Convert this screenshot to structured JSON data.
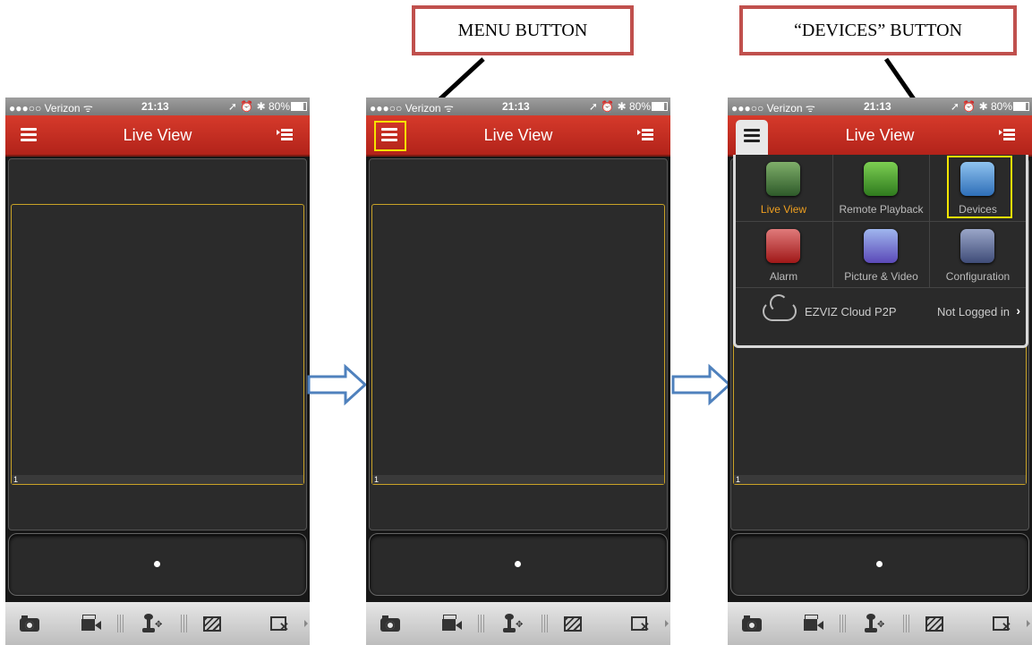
{
  "annotations": {
    "menu_label": "MENU BUTTON",
    "devices_label": "“DEVICES” BUTTON",
    "border_color": "#c0504d",
    "highlight_color": "#f5e600"
  },
  "statusbar": {
    "carrier": "●●●○○ Verizon ᯤ",
    "time": "21:13",
    "right": "➚ ⏰ ✱ 80%"
  },
  "navbar": {
    "title": "Live View",
    "accent": "#c62e22"
  },
  "viewer": {
    "channel_number": "1"
  },
  "toolbar": {
    "icons": [
      "camera-icon",
      "record-video-icon",
      "ptz-joystick-icon",
      "image-quality-icon",
      "close-window-icon"
    ]
  },
  "menu": {
    "items": [
      {
        "label": "Live View",
        "icon": "live-view-icon",
        "active": true
      },
      {
        "label": "Remote Playback",
        "icon": "remote-playback-icon"
      },
      {
        "label": "Devices",
        "icon": "devices-icon"
      },
      {
        "label": "Alarm",
        "icon": "alarm-icon"
      },
      {
        "label": "Picture & Video",
        "icon": "picture-video-icon"
      },
      {
        "label": "Configuration",
        "icon": "configuration-icon"
      }
    ],
    "cloud_label": "EZVIZ Cloud P2P",
    "login_status": "Not Logged in"
  }
}
